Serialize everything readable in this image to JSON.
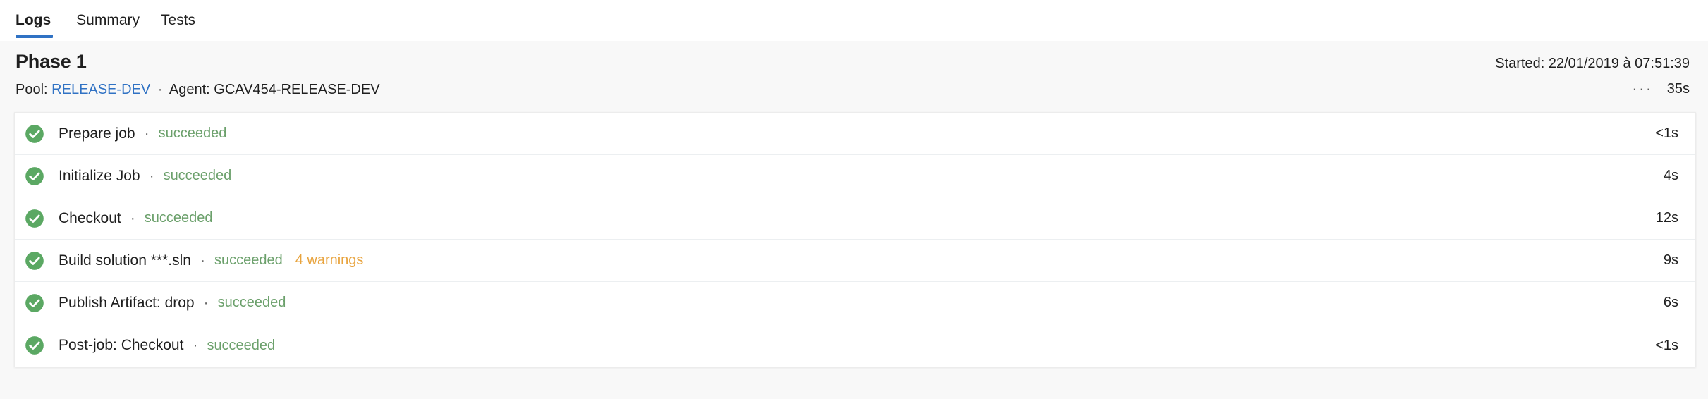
{
  "tabs": [
    {
      "label": "Logs",
      "active": true
    },
    {
      "label": "Summary",
      "active": false
    },
    {
      "label": "Tests",
      "active": false
    }
  ],
  "header": {
    "phase_title": "Phase 1",
    "started_label": "Started: 22/01/2019 à 07:51:39",
    "pool_prefix": "Pool:",
    "pool_name": "RELEASE-DEV",
    "separator": "·",
    "agent_label": "Agent: GCAV454-RELEASE-DEV",
    "more_actions": "···",
    "total_duration": "35s"
  },
  "colors": {
    "accent_blue": "#3072c4",
    "success_green": "#6ba06b",
    "icon_green": "#5ba863",
    "warning_orange": "#e8a33d",
    "page_background": "#f8f8f8"
  },
  "tasks": [
    {
      "icon": "success-check-icon",
      "name": "Prepare job",
      "separator": "·",
      "status": "succeeded",
      "warnings": "",
      "duration": "<1s"
    },
    {
      "icon": "success-check-icon",
      "name": "Initialize Job",
      "separator": "·",
      "status": "succeeded",
      "warnings": "",
      "duration": "4s"
    },
    {
      "icon": "success-check-icon",
      "name": "Checkout",
      "separator": "·",
      "status": "succeeded",
      "warnings": "",
      "duration": "12s"
    },
    {
      "icon": "success-check-icon",
      "name": "Build solution ***.sln",
      "separator": "·",
      "status": "succeeded",
      "warnings": "4 warnings",
      "duration": "9s"
    },
    {
      "icon": "success-check-icon",
      "name": "Publish Artifact: drop",
      "separator": "·",
      "status": "succeeded",
      "warnings": "",
      "duration": "6s"
    },
    {
      "icon": "success-check-icon",
      "name": "Post-job: Checkout",
      "separator": "·",
      "status": "succeeded",
      "warnings": "",
      "duration": "<1s"
    }
  ]
}
